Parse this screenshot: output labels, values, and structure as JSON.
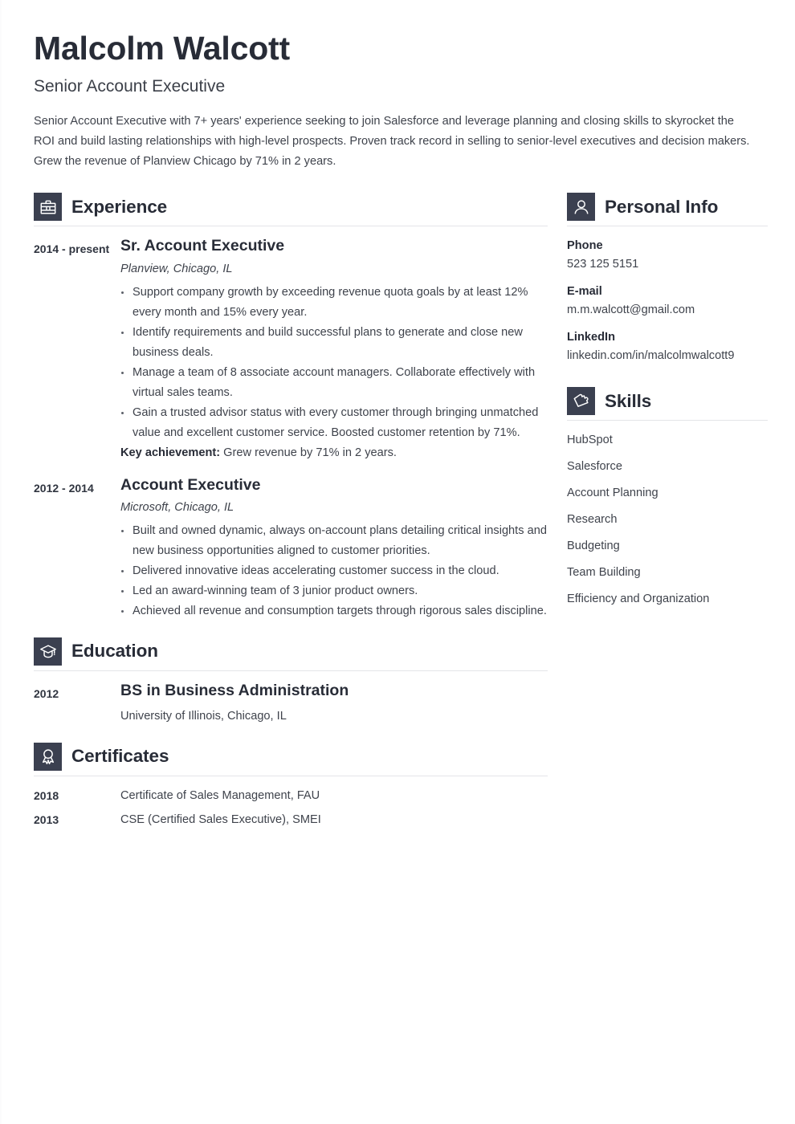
{
  "header": {
    "name": "Malcolm Walcott",
    "job_title": "Senior Account Executive",
    "summary": "Senior Account Executive with 7+ years' experience seeking to join Salesforce and leverage planning and closing skills to skyrocket the ROI and build lasting relationships with high-level prospects. Proven track record in selling to senior-level executives and decision makers. Grew the revenue of Planview Chicago by 71% in 2 years."
  },
  "theme": {
    "icon_box_color": "#3b4050",
    "heading_color": "#282c37",
    "text_color": "#3f434c",
    "rule_color": "#e4e5e8",
    "background": "#ffffff"
  },
  "sections": {
    "experience": {
      "title": "Experience",
      "icon": "briefcase-icon",
      "entries": [
        {
          "dates": "2014 - present",
          "role": "Sr. Account Executive",
          "org": "Planview, Chicago, IL",
          "bullets": [
            "Support company growth by exceeding revenue quota goals by at least 12% every month and 15% every year.",
            "Identify requirements and build successful plans to generate and close new business deals.",
            "Manage a team of 8 associate account managers. Collaborate effectively with virtual sales teams.",
            "Gain a trusted advisor status with every customer through bringing unmatched value and excellent customer service. Boosted customer retention by 71%."
          ],
          "key_achievement_label": "Key achievement:",
          "key_achievement_text": " Grew revenue by 71% in 2 years."
        },
        {
          "dates": "2012 - 2014",
          "role": "Account Executive",
          "org": "Microsoft, Chicago, IL",
          "bullets": [
            "Built and owned dynamic, always on-account plans detailing critical insights and new business opportunities aligned to customer priorities.",
            "Delivered innovative ideas accelerating customer success in the cloud.",
            "Led an award-winning team of 3 junior product owners.",
            "Achieved all revenue and consumption targets through rigorous sales discipline."
          ]
        }
      ]
    },
    "education": {
      "title": "Education",
      "icon": "graduation-cap-icon",
      "entries": [
        {
          "dates": "2012",
          "degree": "BS in Business Administration",
          "school": "University of Illinois, Chicago, IL"
        }
      ]
    },
    "certificates": {
      "title": "Certificates",
      "icon": "award-ribbon-icon",
      "entries": [
        {
          "year": "2018",
          "name": "Certificate of Sales Management, FAU"
        },
        {
          "year": "2013",
          "name": "CSE (Certified Sales Executive), SMEI"
        }
      ]
    },
    "personal_info": {
      "title": "Personal Info",
      "icon": "person-icon",
      "items": [
        {
          "label": "Phone",
          "value": "523 125 5151"
        },
        {
          "label": "E-mail",
          "value": "m.m.walcott@gmail.com"
        },
        {
          "label": "LinkedIn",
          "value": "linkedin.com/in/malcolmwalcott9"
        }
      ]
    },
    "skills": {
      "title": "Skills",
      "icon": "puzzle-piece-icon",
      "items": [
        "HubSpot",
        "Salesforce",
        "Account Planning",
        "Research",
        "Budgeting",
        "Team Building",
        "Efficiency and Organization"
      ]
    }
  }
}
